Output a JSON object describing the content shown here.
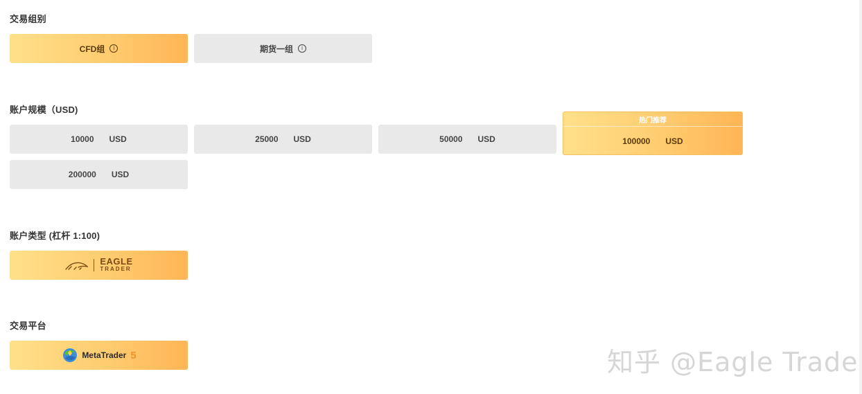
{
  "sections": {
    "trading_group": {
      "title": "交易组别",
      "options": [
        {
          "label": "CFD组",
          "selected": true
        },
        {
          "label": "期货一组",
          "selected": false
        }
      ],
      "info_glyph": "i"
    },
    "account_size": {
      "title": "账户规模（USD)",
      "currency": "USD",
      "options": [
        {
          "amount": "10000",
          "selected": false
        },
        {
          "amount": "25000",
          "selected": false
        },
        {
          "amount": "50000",
          "selected": false
        },
        {
          "amount": "100000",
          "selected": true,
          "tag": "热门推荐"
        },
        {
          "amount": "200000",
          "selected": false
        }
      ]
    },
    "account_type": {
      "title": "账户类型 (杠杆 1:100)",
      "logo": {
        "main": "EAGLE",
        "sub": "TRADER"
      },
      "selected": true
    },
    "platform": {
      "title": "交易平台",
      "logo": {
        "name": "MetaTrader",
        "version": "5"
      },
      "selected": true
    }
  },
  "watermark": "知乎 @Eagle Trader",
  "colors": {
    "gold_start": "#ffe08a",
    "gold_end": "#ffb555",
    "grey": "#e9e9e9",
    "mt_orange": "#f0902a"
  }
}
